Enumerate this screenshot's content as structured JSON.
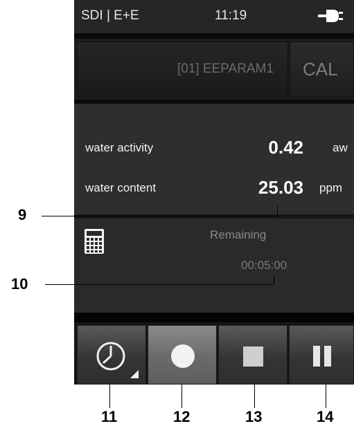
{
  "status_bar": {
    "brand": "SDI | E+E",
    "time": "11:19",
    "power_icon": "plug-icon"
  },
  "header": {
    "parameter_label": "[01] EEPARAM1",
    "cal_label": "CAL"
  },
  "measurements": [
    {
      "label": "water activity",
      "value": "0.42",
      "unit": "aw"
    },
    {
      "label": "water content",
      "value": "25.03",
      "unit": "ppm"
    }
  ],
  "timer": {
    "icon": "calculator-icon",
    "remaining_label": "Remaining",
    "remaining_time": "00:05:00"
  },
  "toolbar": {
    "buttons": [
      {
        "name": "interval",
        "icon": "clock-icon"
      },
      {
        "name": "record",
        "icon": "circle-icon",
        "active": true
      },
      {
        "name": "stop",
        "icon": "square-icon"
      },
      {
        "name": "pause",
        "icon": "pause-icon"
      }
    ]
  },
  "callouts": [
    "9",
    "10",
    "11",
    "12",
    "13",
    "14"
  ],
  "colors": {
    "screen_background": "#2a2a2a",
    "text": "#ffffff",
    "dim_text": "#7a7a7a",
    "active_button": "#6a6a6a"
  }
}
